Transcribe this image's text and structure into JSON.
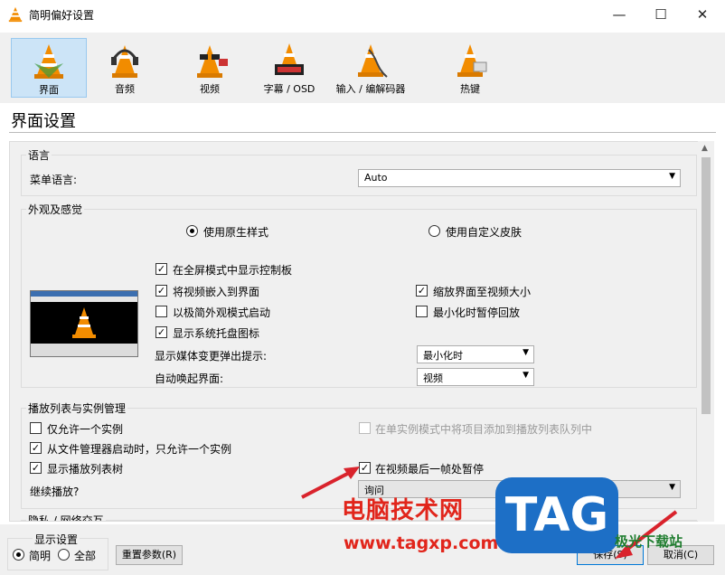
{
  "window": {
    "title": "简明偏好设置",
    "min_glyph": "—",
    "max_glyph": "☐",
    "close_glyph": "✕"
  },
  "categories": [
    {
      "label": "界面",
      "icon": "cone-interface-icon",
      "selected": true
    },
    {
      "label": "音频",
      "icon": "cone-headphones-icon"
    },
    {
      "label": "视频",
      "icon": "cone-glasses-icon"
    },
    {
      "label": "字幕 / OSD",
      "icon": "cone-subtitle-icon"
    },
    {
      "label": "输入 / 编解码器",
      "icon": "cone-cable-icon"
    },
    {
      "label": "热键",
      "icon": "cone-hotkey-icon"
    }
  ],
  "section_title": "界面设置",
  "language": {
    "group_label": "语言",
    "menu_language_label": "菜单语言:",
    "menu_language_value": "Auto"
  },
  "appearance": {
    "group_label": "外观及感觉",
    "native_style_label": "使用原生样式",
    "custom_skin_label": "使用自定义皮肤",
    "fullscreen_controls_label": "在全屏模式中显示控制板",
    "embed_video_label": "将视频嵌入到界面",
    "resize_to_video_label": "缩放界面至视频大小",
    "minimal_start_label": "以极简外观模式启动",
    "pause_minimized_label": "最小化时暂停回放",
    "systray_label": "显示系统托盘图标",
    "popup_label": "显示媒体变更弹出提示:",
    "popup_value": "最小化时",
    "raise_label": "自动唤起界面:",
    "raise_value": "视频"
  },
  "playlist": {
    "group_label": "播放列表与实例管理",
    "one_instance_label": "仅允许一个实例",
    "enqueue_label": "在单实例模式中将项目添加到播放列表队列中",
    "one_instance_fm_label": "从文件管理器启动时，只允许一个实例",
    "show_tree_label": "显示播放列表树",
    "pause_last_frame_label": "在视频最后一帧处暂停",
    "continue_label": "继续播放?",
    "continue_value": "询问"
  },
  "privacy": {
    "group_label": "隐私 / 网络交互"
  },
  "footer": {
    "display_group_label": "显示设置",
    "simple_label": "简明",
    "all_label": "全部",
    "reset_label": "重置参数(R)",
    "save_label": "保存(S)",
    "cancel_label": "取消(C)"
  },
  "watermark": {
    "site_cn": "电脑技术网",
    "url": "www.tagxp.com",
    "logo": "TAG",
    "site2": "极光下载站"
  },
  "colors": {
    "selected_bg": "#cce4f7",
    "cone_orange": "#f28c00",
    "annotation_red": "#d9232c"
  }
}
